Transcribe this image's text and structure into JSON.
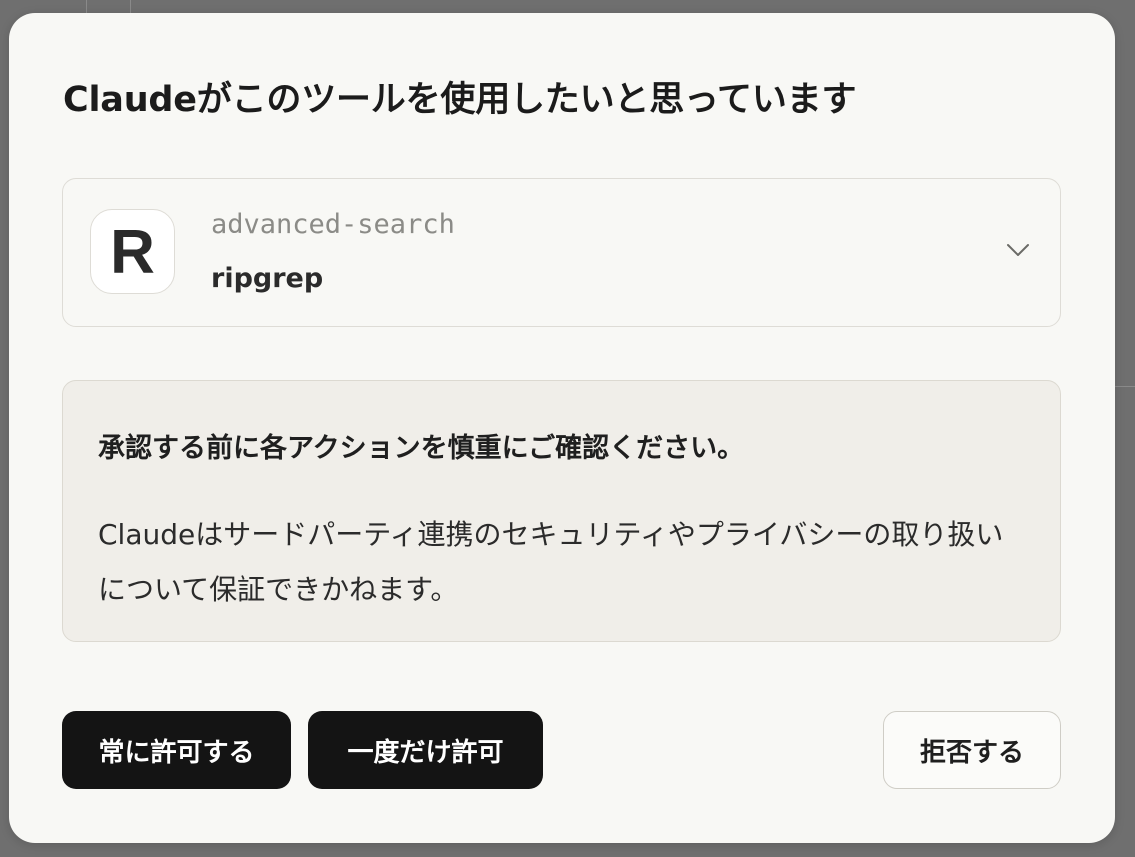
{
  "dialog": {
    "title": "Claudeがこのツールを使用したいと思っています"
  },
  "tool": {
    "logo_letter": "R",
    "server_name": "advanced-search",
    "tool_name": "ripgrep",
    "expand_icon": "chevron-down-icon"
  },
  "notice": {
    "heading": "承認する前に各アクションを慎重にご確認ください。",
    "body": "Claudeはサードパーティ連携のセキュリティやプライバシーの取り扱いについて保証できかねます。"
  },
  "actions": {
    "always_allow": "常に許可する",
    "allow_once": "一度だけ許可",
    "deny": "拒否する"
  },
  "colors": {
    "dialog_background": "#f8f8f5",
    "notice_background": "#f0eee9",
    "primary_button": "#141414",
    "overlay": "#6f6f6f"
  }
}
